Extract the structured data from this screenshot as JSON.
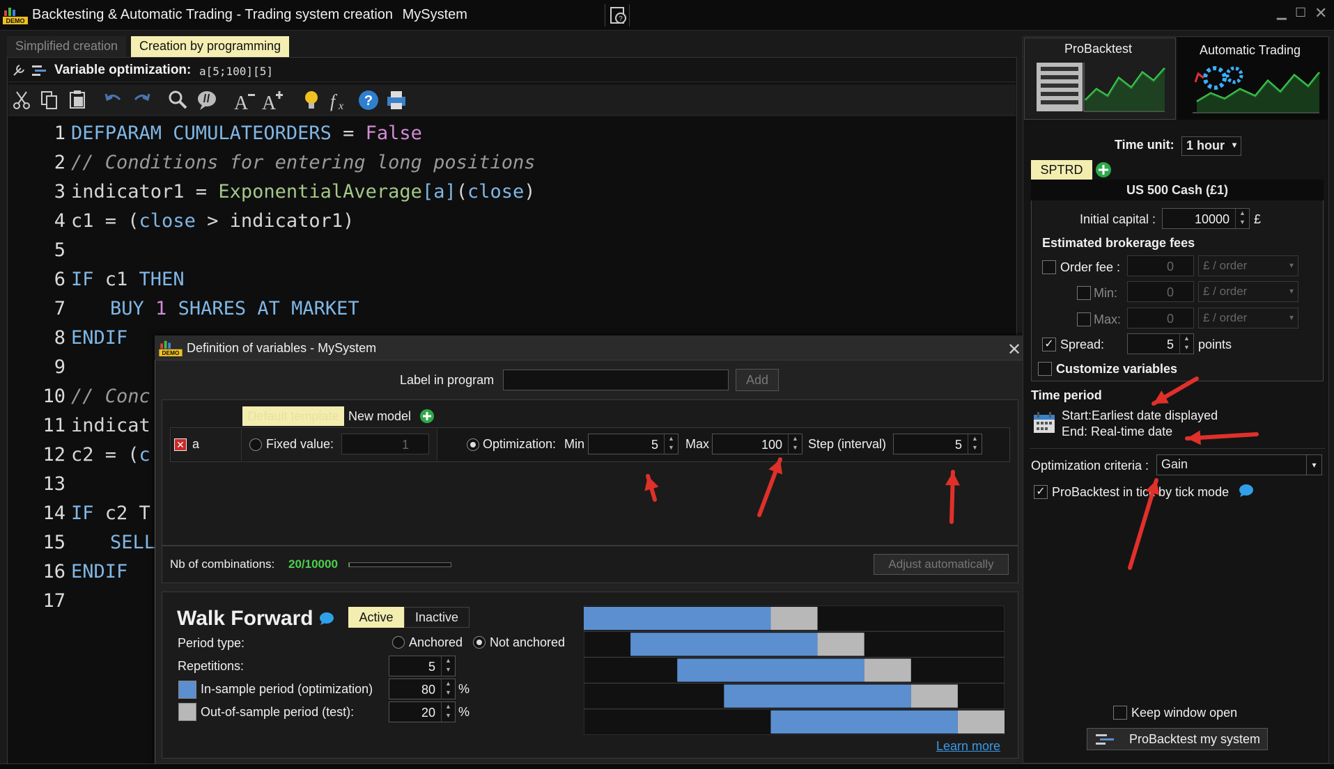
{
  "window": {
    "title": "Backtesting & Automatic Trading - Trading system creation",
    "system_name": "MySystem",
    "demo_badge": "DEMO"
  },
  "tabs": [
    "Simplified creation",
    "Creation by programming"
  ],
  "editor": {
    "var_opt_label": "Variable optimization:",
    "var_opt_value": "a[5;100][5]",
    "line_numbers": [
      "1",
      "2",
      "3",
      "4",
      "5",
      "6",
      "7",
      "8",
      "9",
      "10",
      "11",
      "12",
      "13",
      "14",
      "15",
      "16",
      "17"
    ]
  },
  "code": {
    "l1_kw": "DEFPARAM CUMULATEORDERS",
    "l1_eq": " = ",
    "l1_val": "False",
    "l2": "// Conditions for entering long positions",
    "l3_a": "indicator1 = ",
    "l3_fn": "ExponentialAverage",
    "l3_b": "[a]",
    "l3_c": "(",
    "l3_d": "close",
    "l3_e": ")",
    "l4_a": "c1 = (",
    "l4_b": "close",
    "l4_c": " > indicator1)",
    "l6_kw1": "IF",
    "l6_a": " c1 ",
    "l6_kw2": "THEN",
    "l7_kw1": "BUY",
    "l7_n": "1",
    "l7_kw2": "SHARES AT MARKET",
    "l8": "ENDIF",
    "l10": "// Conc",
    "l11": "indicat",
    "l12_a": "c2 = (",
    "l12_b": "c",
    "l14_kw": "IF",
    "l14_a": " c2 T",
    "l15": "SELL",
    "l16": "ENDIF"
  },
  "dialog": {
    "title": "Definition of variables - MySystem",
    "label_in_program": "Label in program",
    "label_value": "",
    "add_button": "Add",
    "default_template": "Default template",
    "new_model": "New model",
    "var_name": "a",
    "fixed_value_label": "Fixed value:",
    "fixed_value": "1",
    "optimization_label": "Optimization:",
    "min_label": "Min",
    "min_value": "5",
    "max_label": "Max",
    "max_value": "100",
    "step_label": "Step (interval)",
    "step_value": "5",
    "combinations_label": "Nb of combinations:",
    "combinations_value": "20/10000",
    "combinations_fraction": 0.002,
    "adjust_button": "Adjust automatically"
  },
  "walk_forward": {
    "title": "Walk Forward",
    "active": "Active",
    "inactive": "Inactive",
    "period_type_label": "Period type:",
    "anchored": "Anchored",
    "not_anchored": "Not anchored",
    "repetitions_label": "Repetitions:",
    "repetitions_value": "5",
    "in_sample_label": "In-sample period (optimization)",
    "in_sample_value": "80",
    "out_sample_label": "Out-of-sample period (test):",
    "out_sample_value": "20",
    "percent": "%",
    "learn_more": "Learn more",
    "colors": {
      "in_sample": "#5b8fd0",
      "out_sample": "#b8b8b8"
    }
  },
  "right_panel": {
    "tab_probacktest": "ProBacktest",
    "tab_automatic": "Automatic Trading",
    "time_unit_label": "Time unit:",
    "time_unit_value": "1 hour",
    "ticker": "SPTRD",
    "instrument": "US 500 Cash (£1)",
    "initial_capital_label": "Initial capital :",
    "initial_capital_value": "10000",
    "currency": "£",
    "brokerage_title": "Estimated brokerage fees",
    "order_fee_label": "Order fee :",
    "order_fee_value": "0",
    "per_order": "£ / order",
    "min_label": "Min:",
    "min_value": "0",
    "max_label": "Max:",
    "max_value": "0",
    "spread_label": "Spread:",
    "spread_value": "5",
    "points": "points",
    "customize_variables": "Customize variables",
    "time_period_title": "Time period",
    "start": "Start:Earliest date displayed",
    "end": "End: Real-time date",
    "criteria_label": "Optimization criteria :",
    "criteria_value": "Gain",
    "tick_mode": "ProBacktest in tick by tick mode",
    "keep_open": "Keep window open",
    "run_button": "ProBacktest my system"
  },
  "annotation_color": "#e0302a"
}
